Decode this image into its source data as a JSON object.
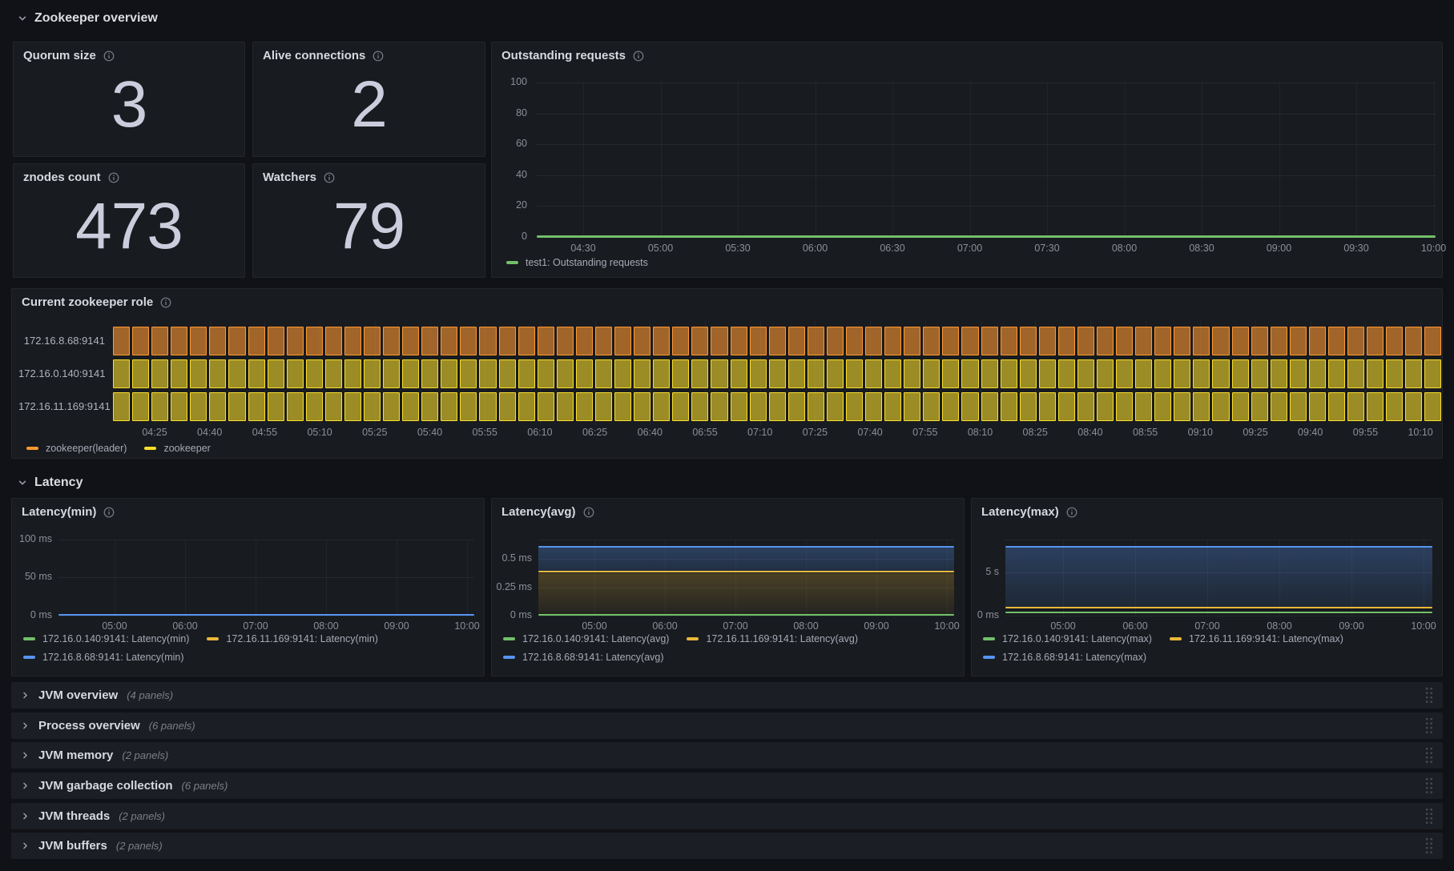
{
  "palette": {
    "green": "#73BF69",
    "yellow_bright": "#FADE2A",
    "yellow_gold": "#EAB839",
    "blue": "#5794F2",
    "orange": "#FF9830",
    "orange_fill": "rgba(255,152,48,0.60)",
    "yellow_fill": "rgba(250,222,42,0.58)",
    "panel_bg": "#181b1f",
    "page_bg": "#111217"
  },
  "sections": [
    {
      "title": "Zookeeper overview"
    },
    {
      "title": "Latency"
    }
  ],
  "stat_panels": [
    {
      "title": "Quorum size",
      "value": "3"
    },
    {
      "title": "Alive connections",
      "value": "2"
    },
    {
      "title": "znodes count",
      "value": "473"
    },
    {
      "title": "Watchers",
      "value": "79"
    }
  ],
  "outstanding_panel": {
    "title": "Outstanding requests",
    "y_ticks": [
      "100",
      "80",
      "60",
      "40",
      "20",
      "0"
    ],
    "x_ticks": [
      "04:30",
      "05:00",
      "05:30",
      "06:00",
      "06:30",
      "07:00",
      "07:30",
      "08:00",
      "08:30",
      "09:00",
      "09:30",
      "10:00"
    ],
    "legend": [
      {
        "label": "test1: Outstanding requests",
        "color": "#73BF69"
      }
    ],
    "series": [
      {
        "name": "test1: Outstanding requests",
        "color": "#73BF69",
        "value": 0
      }
    ]
  },
  "role_panel": {
    "title": "Current zookeeper role",
    "bar_count": 69,
    "rows": [
      {
        "label": "172.16.8.68:9141",
        "state": "zookeeper(leader)",
        "color": "#FF9830",
        "fill": "rgba(255,152,48,0.60)"
      },
      {
        "label": "172.16.0.140:9141",
        "state": "zookeeper",
        "color": "#FADE2A",
        "fill": "rgba(250,222,42,0.58)"
      },
      {
        "label": "172.16.11.169:9141",
        "state": "zookeeper",
        "color": "#FADE2A",
        "fill": "rgba(250,222,42,0.58)"
      }
    ],
    "x_ticks": [
      "04:25",
      "04:40",
      "04:55",
      "05:10",
      "05:25",
      "05:40",
      "05:55",
      "06:10",
      "06:25",
      "06:40",
      "06:55",
      "07:10",
      "07:25",
      "07:40",
      "07:55",
      "08:10",
      "08:25",
      "08:40",
      "08:55",
      "09:10",
      "09:25",
      "09:40",
      "09:55",
      "10:10"
    ],
    "legend": [
      {
        "label": "zookeeper(leader)",
        "color": "#FF9830"
      },
      {
        "label": "zookeeper",
        "color": "#FADE2A"
      }
    ]
  },
  "latency_panels": [
    {
      "title": "Latency(min)",
      "y_ticks": [
        "100 ms",
        "50 ms",
        "0 ms"
      ],
      "x_ticks": [
        "05:00",
        "06:00",
        "07:00",
        "08:00",
        "09:00",
        "10:00"
      ],
      "legend": [
        {
          "label": "172.16.0.140:9141: Latency(min)",
          "color": "#73BF69"
        },
        {
          "label": "172.16.11.169:9141: Latency(min)",
          "color": "#EAB839"
        },
        {
          "label": "172.16.8.68:9141: Latency(min)",
          "color": "#5794F2"
        }
      ],
      "series": [
        {
          "name": "172.16.0.140:9141: Latency(min)",
          "value": "0 ms"
        },
        {
          "name": "172.16.11.169:9141: Latency(min)",
          "value": "0 ms"
        },
        {
          "name": "172.16.8.68:9141: Latency(min)",
          "value": "0 ms"
        }
      ]
    },
    {
      "title": "Latency(avg)",
      "y_ticks": [
        "0.5 ms",
        "0.25 ms",
        "0 ms"
      ],
      "x_ticks": [
        "05:00",
        "06:00",
        "07:00",
        "08:00",
        "09:00",
        "10:00"
      ],
      "legend": [
        {
          "label": "172.16.0.140:9141: Latency(avg)",
          "color": "#73BF69"
        },
        {
          "label": "172.16.11.169:9141: Latency(avg)",
          "color": "#EAB839"
        },
        {
          "label": "172.16.8.68:9141: Latency(avg)",
          "color": "#5794F2"
        }
      ],
      "series": [
        {
          "name": "172.16.0.140:9141: Latency(avg)",
          "value": "0 ms"
        },
        {
          "name": "172.16.11.169:9141: Latency(avg)",
          "value": "~0.39 ms"
        },
        {
          "name": "172.16.8.68:9141: Latency(avg)",
          "value": "~0.6 ms"
        }
      ]
    },
    {
      "title": "Latency(max)",
      "y_ticks": [
        "5 s",
        "0 ms"
      ],
      "x_ticks": [
        "05:00",
        "06:00",
        "07:00",
        "08:00",
        "09:00",
        "10:00"
      ],
      "legend": [
        {
          "label": "172.16.0.140:9141: Latency(max)",
          "color": "#73BF69"
        },
        {
          "label": "172.16.11.169:9141: Latency(max)",
          "color": "#EAB839"
        },
        {
          "label": "172.16.8.68:9141: Latency(max)",
          "color": "#5794F2"
        }
      ],
      "series": [
        {
          "name": "172.16.0.140:9141: Latency(max)",
          "value": "~0.1 s"
        },
        {
          "name": "172.16.11.169:9141: Latency(max)",
          "value": "~0.8 s"
        },
        {
          "name": "172.16.8.68:9141: Latency(max)",
          "value": "~8 s"
        }
      ]
    }
  ],
  "collapsed_rows": [
    {
      "title": "JVM overview",
      "count": "(4 panels)"
    },
    {
      "title": "Process overview",
      "count": "(6 panels)"
    },
    {
      "title": "JVM memory",
      "count": "(2 panels)"
    },
    {
      "title": "JVM garbage collection",
      "count": "(6 panels)"
    },
    {
      "title": "JVM threads",
      "count": "(2 panels)"
    },
    {
      "title": "JVM buffers",
      "count": "(2 panels)"
    }
  ]
}
